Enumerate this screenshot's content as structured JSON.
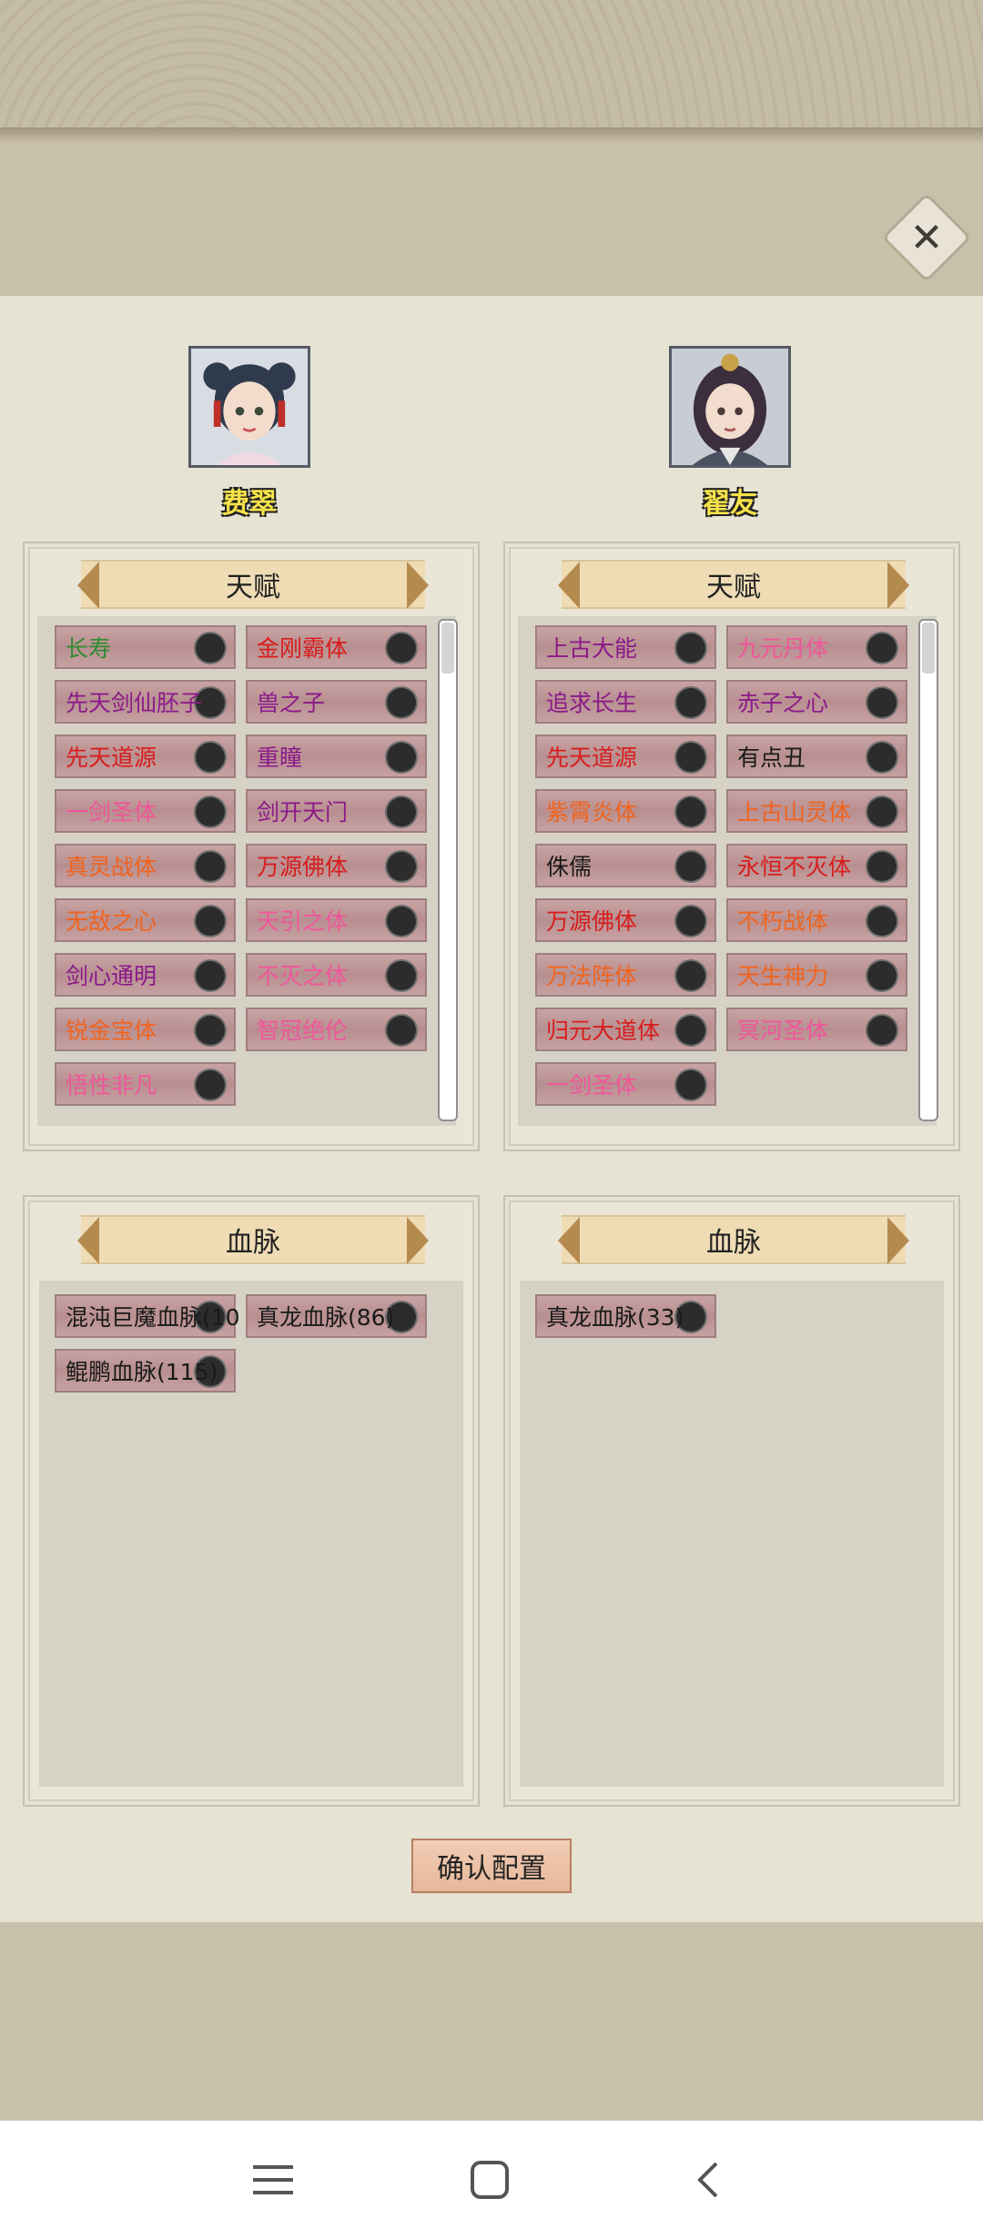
{
  "colors": {
    "green": "#2f8b2f",
    "red": "#d81d1d",
    "purple": "#8b1a8b",
    "pink": "#f0569a",
    "orange": "#f0641e",
    "black": "#1a1a1a"
  },
  "close_icon": "close-icon",
  "left": {
    "name": "费翠",
    "talent_title": "天赋",
    "bloodline_title": "血脉",
    "talents": [
      {
        "label": "长寿",
        "color": "green"
      },
      {
        "label": "金刚霸体",
        "color": "red"
      },
      {
        "label": "先天剑仙胚子",
        "color": "purple"
      },
      {
        "label": "兽之子",
        "color": "purple"
      },
      {
        "label": "先天道源",
        "color": "red"
      },
      {
        "label": "重瞳",
        "color": "purple"
      },
      {
        "label": "一剑圣体",
        "color": "pink"
      },
      {
        "label": "剑开天门",
        "color": "purple"
      },
      {
        "label": "真灵战体",
        "color": "orange"
      },
      {
        "label": "万源佛体",
        "color": "red"
      },
      {
        "label": "无敌之心",
        "color": "orange"
      },
      {
        "label": "天引之体",
        "color": "pink"
      },
      {
        "label": "剑心通明",
        "color": "purple"
      },
      {
        "label": "不灭之体",
        "color": "pink"
      },
      {
        "label": "锐金宝体",
        "color": "orange"
      },
      {
        "label": "智冠绝伦",
        "color": "pink"
      },
      {
        "label": "悟性非凡",
        "color": "pink"
      }
    ],
    "bloodlines": [
      {
        "label": "混沌巨魔血脉(10"
      },
      {
        "label": "真龙血脉(86)"
      },
      {
        "label": "鲲鹏血脉(115)"
      }
    ]
  },
  "right": {
    "name": "翟友",
    "talent_title": "天赋",
    "bloodline_title": "血脉",
    "talents": [
      {
        "label": "上古大能",
        "color": "purple"
      },
      {
        "label": "九元丹体",
        "color": "pink"
      },
      {
        "label": "追求长生",
        "color": "purple"
      },
      {
        "label": "赤子之心",
        "color": "purple"
      },
      {
        "label": "先天道源",
        "color": "red"
      },
      {
        "label": "有点丑",
        "color": "black"
      },
      {
        "label": "紫霄炎体",
        "color": "orange"
      },
      {
        "label": "上古山灵体",
        "color": "orange"
      },
      {
        "label": "侏儒",
        "color": "black"
      },
      {
        "label": "永恒不灭体",
        "color": "red"
      },
      {
        "label": "万源佛体",
        "color": "red"
      },
      {
        "label": "不朽战体",
        "color": "orange"
      },
      {
        "label": "万法阵体",
        "color": "orange"
      },
      {
        "label": "天生神力",
        "color": "orange"
      },
      {
        "label": "归元大道体",
        "color": "red"
      },
      {
        "label": "冥河圣体",
        "color": "pink"
      },
      {
        "label": "一剑圣体",
        "color": "pink"
      }
    ],
    "bloodlines": [
      {
        "label": "真龙血脉(33)"
      }
    ]
  },
  "confirm_label": "确认配置",
  "nav": {
    "menu_icon": "menu-icon",
    "home_icon": "home-icon",
    "back_icon": "back-icon"
  }
}
